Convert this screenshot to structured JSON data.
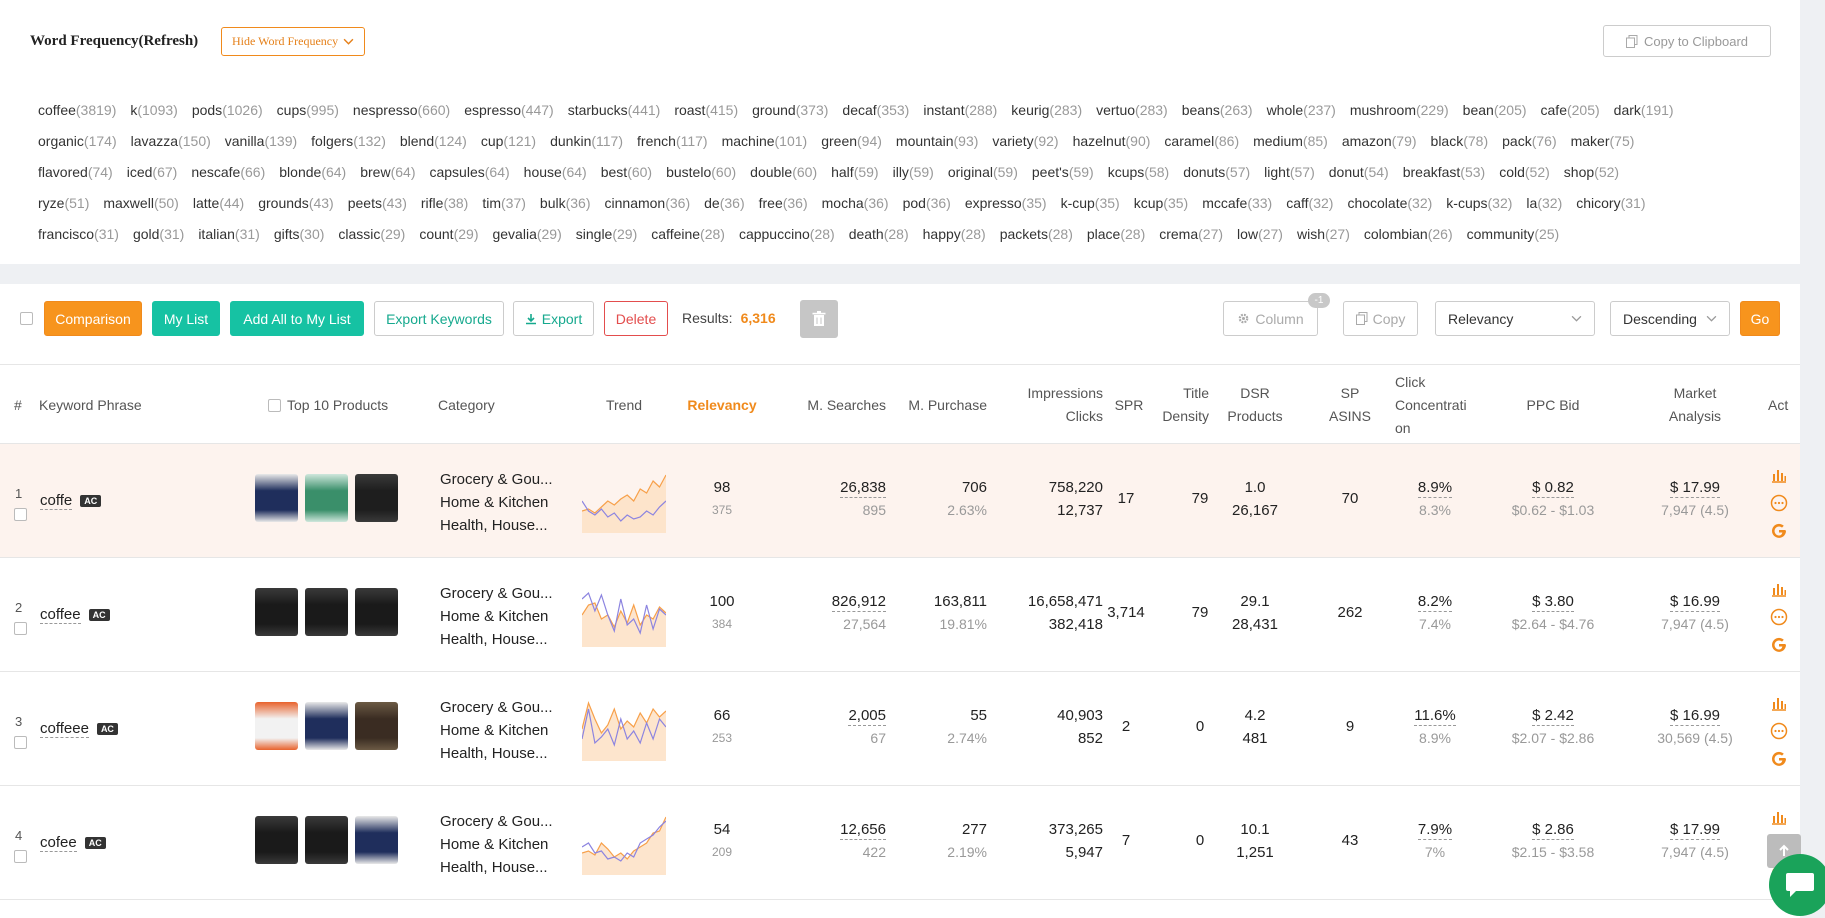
{
  "word_frequency": {
    "title": "Word Frequency(Refresh)",
    "hide_label": "Hide Word Frequency",
    "copy_label": "Copy to Clipboard",
    "rows": [
      [
        [
          "coffee",
          "(3819)"
        ],
        [
          "k",
          "(1093)"
        ],
        [
          "pods",
          "(1026)"
        ],
        [
          "cups",
          "(995)"
        ],
        [
          "nespresso",
          "(660)"
        ],
        [
          "espresso",
          "(447)"
        ],
        [
          "starbucks",
          "(441)"
        ],
        [
          "roast",
          "(415)"
        ],
        [
          "ground",
          "(373)"
        ],
        [
          "decaf",
          "(353)"
        ],
        [
          "instant",
          "(288)"
        ],
        [
          "keurig",
          "(283)"
        ],
        [
          "vertuo",
          "(283)"
        ],
        [
          "beans",
          "(263)"
        ],
        [
          "whole",
          "(237)"
        ],
        [
          "mushroom",
          "(229)"
        ],
        [
          "bean",
          "(205)"
        ],
        [
          "cafe",
          "(205)"
        ],
        [
          "dark",
          "(191)"
        ]
      ],
      [
        [
          "organic",
          "(174)"
        ],
        [
          "lavazza",
          "(150)"
        ],
        [
          "vanilla",
          "(139)"
        ],
        [
          "folgers",
          "(132)"
        ],
        [
          "blend",
          "(124)"
        ],
        [
          "cup",
          "(121)"
        ],
        [
          "dunkin",
          "(117)"
        ],
        [
          "french",
          "(117)"
        ],
        [
          "machine",
          "(101)"
        ],
        [
          "green",
          "(94)"
        ],
        [
          "mountain",
          "(93)"
        ],
        [
          "variety",
          "(92)"
        ],
        [
          "hazelnut",
          "(90)"
        ],
        [
          "caramel",
          "(86)"
        ],
        [
          "medium",
          "(85)"
        ],
        [
          "amazon",
          "(79)"
        ],
        [
          "black",
          "(78)"
        ],
        [
          "pack",
          "(76)"
        ],
        [
          "maker",
          "(75)"
        ]
      ],
      [
        [
          "flavored",
          "(74)"
        ],
        [
          "iced",
          "(67)"
        ],
        [
          "nescafe",
          "(66)"
        ],
        [
          "blonde",
          "(64)"
        ],
        [
          "brew",
          "(64)"
        ],
        [
          "capsules",
          "(64)"
        ],
        [
          "house",
          "(64)"
        ],
        [
          "best",
          "(60)"
        ],
        [
          "bustelo",
          "(60)"
        ],
        [
          "double",
          "(60)"
        ],
        [
          "half",
          "(59)"
        ],
        [
          "illy",
          "(59)"
        ],
        [
          "original",
          "(59)"
        ],
        [
          "peet's",
          "(59)"
        ],
        [
          "kcups",
          "(58)"
        ],
        [
          "donuts",
          "(57)"
        ],
        [
          "light",
          "(57)"
        ],
        [
          "donut",
          "(54)"
        ],
        [
          "breakfast",
          "(53)"
        ],
        [
          "cold",
          "(52)"
        ],
        [
          "shop",
          "(52)"
        ]
      ],
      [
        [
          "ryze",
          "(51)"
        ],
        [
          "maxwell",
          "(50)"
        ],
        [
          "latte",
          "(44)"
        ],
        [
          "grounds",
          "(43)"
        ],
        [
          "peets",
          "(43)"
        ],
        [
          "rifle",
          "(38)"
        ],
        [
          "tim",
          "(37)"
        ],
        [
          "bulk",
          "(36)"
        ],
        [
          "cinnamon",
          "(36)"
        ],
        [
          "de",
          "(36)"
        ],
        [
          "free",
          "(36)"
        ],
        [
          "mocha",
          "(36)"
        ],
        [
          "pod",
          "(36)"
        ],
        [
          "expresso",
          "(35)"
        ],
        [
          "k-cup",
          "(35)"
        ],
        [
          "kcup",
          "(35)"
        ],
        [
          "mccafe",
          "(33)"
        ],
        [
          "caff",
          "(32)"
        ],
        [
          "chocolate",
          "(32)"
        ],
        [
          "k-cups",
          "(32)"
        ],
        [
          "la",
          "(32)"
        ],
        [
          "chicory",
          "(31)"
        ]
      ],
      [
        [
          "francisco",
          "(31)"
        ],
        [
          "gold",
          "(31)"
        ],
        [
          "italian",
          "(31)"
        ],
        [
          "gifts",
          "(30)"
        ],
        [
          "classic",
          "(29)"
        ],
        [
          "count",
          "(29)"
        ],
        [
          "gevalia",
          "(29)"
        ],
        [
          "single",
          "(29)"
        ],
        [
          "caffeine",
          "(28)"
        ],
        [
          "cappuccino",
          "(28)"
        ],
        [
          "death",
          "(28)"
        ],
        [
          "happy",
          "(28)"
        ],
        [
          "packets",
          "(28)"
        ],
        [
          "place",
          "(28)"
        ],
        [
          "crema",
          "(27)"
        ],
        [
          "low",
          "(27)"
        ],
        [
          "wish",
          "(27)"
        ],
        [
          "colombian",
          "(26)"
        ],
        [
          "community",
          "(25)"
        ]
      ]
    ]
  },
  "toolbar": {
    "comparison": "Comparison",
    "my_list": "My List",
    "add_all": "Add All to My List",
    "export_keywords": "Export Keywords",
    "export": "Export",
    "delete": "Delete",
    "results_label": "Results:",
    "results_value": "6,316",
    "column": "Column",
    "column_badge": "-1",
    "copy": "Copy",
    "sort_field": "Relevancy",
    "sort_order": "Descending",
    "go": "Go"
  },
  "columns": {
    "num": "#",
    "keyword": "Keyword Phrase",
    "top10": "Top 10 Products",
    "category": "Category",
    "trend": "Trend",
    "relevancy": "Relevancy",
    "m_searches": "M. Searches",
    "m_purchase": "M. Purchase",
    "impressions": "Impressions",
    "clicks": "Clicks",
    "spr": "SPR",
    "title_density_1": "Title",
    "title_density_2": "Density",
    "dsr_1": "DSR",
    "dsr_2": "Products",
    "sp_1": "SP",
    "sp_2": "ASINS",
    "click_1": "Click",
    "click_2": "Concentrati",
    "click_3": "on",
    "ppc": "PPC Bid",
    "market_1": "Market",
    "market_2": "Analysis",
    "act": "Act"
  },
  "rows": [
    {
      "num": "1",
      "keyword": "coffe",
      "ac": "AC",
      "cat1": "Grocery & Gou...",
      "cat2": "Home & Kitchen",
      "cat3": "Health, House...",
      "rel": "98",
      "rel_sub": "375",
      "ms": "26,838",
      "ms_sub": "895",
      "mp": "706",
      "mp_sub": "2.63%",
      "imp": "758,220",
      "clk": "12,737",
      "spr": "17",
      "td": "79",
      "dsr1": "1.0",
      "dsr2": "26,167",
      "sp": "70",
      "cc1": "8.9%",
      "cc2": "8.3%",
      "ppc1": "$ 0.82",
      "ppc2": "$0.62 - $1.03",
      "ma1": "$ 17.99",
      "ma2": "7,947 (4.5)"
    },
    {
      "num": "2",
      "keyword": "coffee",
      "ac": "AC",
      "cat1": "Grocery & Gou...",
      "cat2": "Home & Kitchen",
      "cat3": "Health, House...",
      "rel": "100",
      "rel_sub": "384",
      "ms": "826,912",
      "ms_sub": "27,564",
      "mp": "163,811",
      "mp_sub": "19.81%",
      "imp": "16,658,471",
      "clk": "382,418",
      "spr": "3,714",
      "td": "79",
      "dsr1": "29.1",
      "dsr2": "28,431",
      "sp": "262",
      "cc1": "8.2%",
      "cc2": "7.4%",
      "ppc1": "$ 3.80",
      "ppc2": "$2.64 - $4.76",
      "ma1": "$ 16.99",
      "ma2": "7,947 (4.5)"
    },
    {
      "num": "3",
      "keyword": "coffeee",
      "ac": "AC",
      "cat1": "Grocery & Gou...",
      "cat2": "Home & Kitchen",
      "cat3": "Health, House...",
      "rel": "66",
      "rel_sub": "253",
      "ms": "2,005",
      "ms_sub": "67",
      "mp": "55",
      "mp_sub": "2.74%",
      "imp": "40,903",
      "clk": "852",
      "spr": "2",
      "td": "0",
      "dsr1": "4.2",
      "dsr2": "481",
      "sp": "9",
      "cc1": "11.6%",
      "cc2": "8.9%",
      "ppc1": "$ 2.42",
      "ppc2": "$2.07 - $2.86",
      "ma1": "$ 16.99",
      "ma2": "30,569 (4.5)"
    },
    {
      "num": "4",
      "keyword": "cofee",
      "ac": "AC",
      "cat1": "Grocery & Gou...",
      "cat2": "Home & Kitchen",
      "cat3": "Health, House...",
      "rel": "54",
      "rel_sub": "209",
      "ms": "12,656",
      "ms_sub": "422",
      "mp": "277",
      "mp_sub": "2.19%",
      "imp": "373,265",
      "clk": "5,947",
      "spr": "7",
      "td": "0",
      "dsr1": "10.1",
      "dsr2": "1,251",
      "sp": "43",
      "cc1": "7.9%",
      "cc2": "7%",
      "ppc1": "$ 2.86",
      "ppc2": "$2.15 - $3.58",
      "ma1": "$ 17.99",
      "ma2": "7,947 (4.5)"
    }
  ],
  "colors": {
    "accent": "#f7941d",
    "teal": "#16c2a3",
    "danger": "#e34d4d",
    "highlight_row": "#fdf3ee"
  },
  "icons": [
    "copy-icon",
    "chevron-down-icon",
    "gear-icon",
    "download-icon",
    "trash-icon",
    "bar-chart-icon",
    "more-icon",
    "google-icon",
    "arrow-up-icon",
    "chat-icon"
  ]
}
